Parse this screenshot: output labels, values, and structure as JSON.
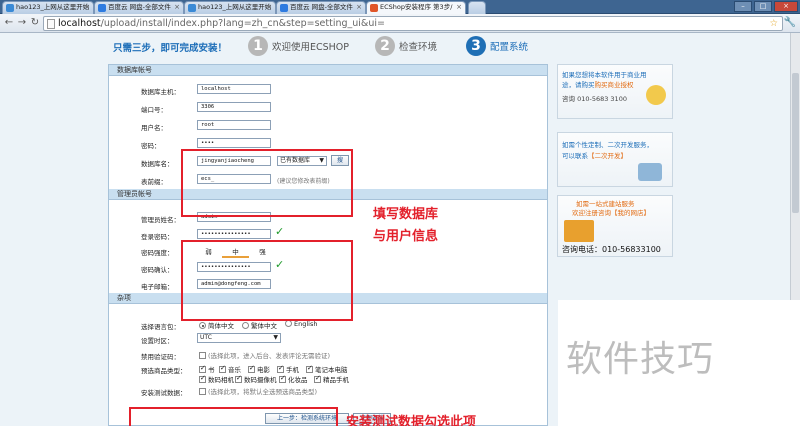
{
  "browser": {
    "tabs": [
      {
        "label": "hao123_上网从这里开始",
        "color": "#3a8ad6",
        "active": false
      },
      {
        "label": "百度云 网盘-全部文件",
        "color": "#2e7be0",
        "active": false
      },
      {
        "label": "hao123_上网从这里开始",
        "color": "#3a8ad6",
        "active": false
      },
      {
        "label": "百度云 网盘-全部文件",
        "color": "#2e7be0",
        "active": false
      },
      {
        "label": "ECShop安装程序 第3步/",
        "color": "#e0562a",
        "active": true
      }
    ],
    "url_host": "localhost",
    "url_rest": "/upload/install/index.php?lang=zh_cn&step=setting_ui&ui="
  },
  "steps": {
    "intro": "只需三步，即可完成安装！",
    "items": [
      {
        "num": "1",
        "label": "欢迎使用ECSHOP",
        "active": false
      },
      {
        "num": "2",
        "label": "检查环境",
        "active": false
      },
      {
        "num": "3",
        "label": "配置系统",
        "active": true
      }
    ]
  },
  "database": {
    "title": "数据库帐号",
    "host_label": "数据库主机：",
    "host_value": "localhost",
    "port_label": "端口号：",
    "port_value": "3306",
    "user_label": "用户名：",
    "user_value": "root",
    "pass_label": "密码：",
    "pass_value": "••••",
    "name_label": "数据库名：",
    "name_value": "jingyanjiaocheng",
    "existing_select": "已有数据库",
    "search_button": "搜",
    "prefix_label": "表前缀：",
    "prefix_value": "ecs_",
    "prefix_hint": "(建议您修改表前缀)"
  },
  "admin": {
    "title": "管理员帐号",
    "name_label": "管理员姓名：",
    "name_value": "admin",
    "pass_label": "登录密码：",
    "pass_value": "•••••••••••••••",
    "strength_label": "密码强度：",
    "strength_levels": [
      "弱",
      "中",
      "强"
    ],
    "confirm_label": "密码确认：",
    "confirm_value": "•••••••••••••••",
    "email_label": "电子邮箱：",
    "email_value": "admin@dongfeng.com"
  },
  "misc": {
    "title": "杂项",
    "lang_label": "选择语言包：",
    "lang_options": [
      "简体中文",
      "繁体中文",
      "English"
    ],
    "tz_label": "设置时区：",
    "tz_value": "UTC",
    "captcha_label": "禁用验证码：",
    "captcha_text": "(选择此项，进入后台、发表评论无需验证)",
    "goods_label": "预选商品类型：",
    "goods_row1": [
      "书",
      "音乐",
      "电影",
      "手机",
      "笔记本电脑"
    ],
    "goods_row2": [
      "数码相机",
      "数码摄像机",
      "化妆品",
      "精品手机"
    ],
    "test_label": "安装测试数据：",
    "test_text": "(选择此项，将默认全选预选商品类型)"
  },
  "buttons": {
    "prev": "上一步：检测系统环境",
    "install": "立即安装"
  },
  "annotations": {
    "db_note_line1": "填写数据库",
    "db_note_line2": "与用户信息",
    "test_note": "安装测试数据勾选此项"
  },
  "ads": {
    "ad1_line1": "如果您想将本软件用于商业用",
    "ad1_line2_a": "途，请购买",
    "ad1_line2_link": "购买商业授权",
    "ad1_phone": "咨询 010-5683 3100",
    "ad2_line1": "如需个性定制、二次开发服务，",
    "ad2_line2_a": "可以联系",
    "ad2_line2_link": "【二次开发】",
    "ad3_line1": "如需一站式建站服务",
    "ad3_line2": "欢迎注册咨询【我的网店】",
    "ad3_phone": "咨询电话：010-56833100"
  },
  "watermark": "软件技巧",
  "colors": {
    "accent": "#1f6fb5",
    "annotation": "#e3202b",
    "check": "#1e9a2a"
  }
}
